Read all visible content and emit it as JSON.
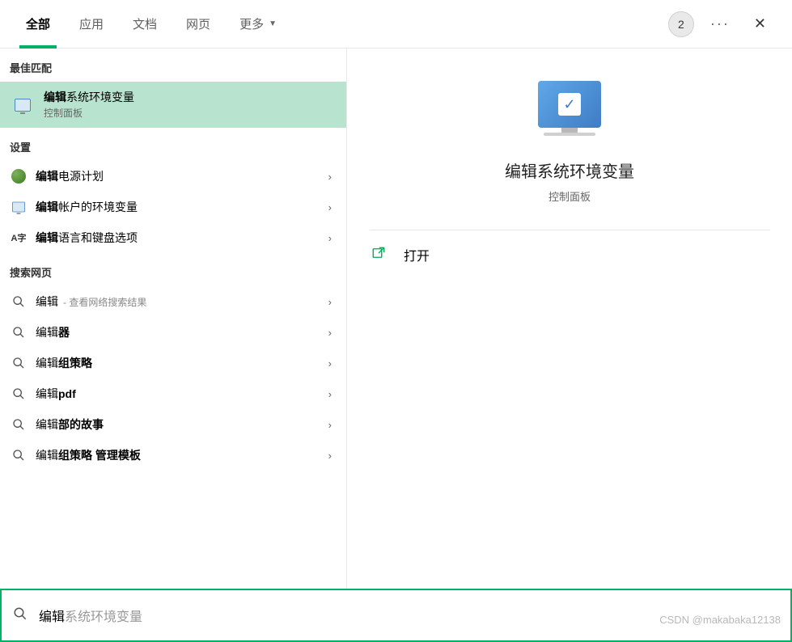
{
  "tabs": {
    "items": [
      "全部",
      "应用",
      "文档",
      "网页",
      "更多"
    ],
    "active_index": 0,
    "badge": "2"
  },
  "sections": {
    "best_match": "最佳匹配",
    "settings": "设置",
    "web": "搜索网页"
  },
  "best": {
    "title_bold": "编辑",
    "title_rest": "系统环境变量",
    "sub": "控制面板"
  },
  "settings_items": [
    {
      "bold": "编辑",
      "rest": "电源计划",
      "icon": "battery"
    },
    {
      "bold": "编辑",
      "rest": "帐户的环境变量",
      "icon": "monitor"
    },
    {
      "bold": "编辑",
      "rest": "语言和键盘选项",
      "icon": "az"
    }
  ],
  "web_hint": "查看网络搜索结果",
  "web_items": [
    {
      "prefix": "编辑",
      "bold": "",
      "hint": true
    },
    {
      "prefix": "编辑",
      "bold": "器"
    },
    {
      "prefix": "编辑",
      "bold": "组策略"
    },
    {
      "prefix": "编辑",
      "bold": "pdf"
    },
    {
      "prefix": "编辑",
      "bold": "部的故事"
    },
    {
      "prefix": "编辑",
      "bold": "组策略 管理模板"
    }
  ],
  "preview": {
    "title": "编辑系统环境变量",
    "sub": "控制面板",
    "action_open": "打开"
  },
  "search": {
    "typed": "编辑",
    "ghost": "系统环境变量"
  },
  "watermark": "CSDN @makabaka12138",
  "az_glyph": "A字"
}
